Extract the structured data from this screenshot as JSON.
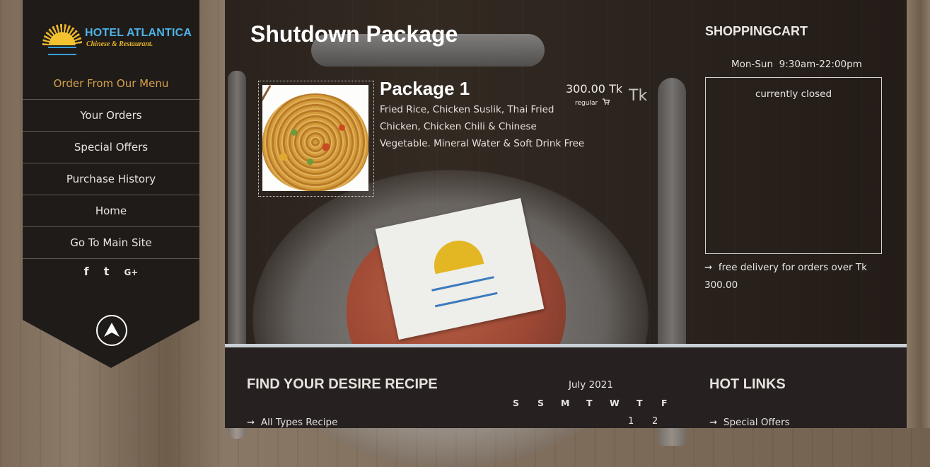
{
  "brand": {
    "name": "HOTEL ATLANTICA",
    "tagline": "Chinese & Restaurant."
  },
  "sidebar": {
    "items": [
      {
        "label": "Order From Our Menu",
        "active": true
      },
      {
        "label": "Your Orders"
      },
      {
        "label": "Special Offers"
      },
      {
        "label": "Purchase History"
      },
      {
        "label": "Home"
      },
      {
        "label": "Go To Main Site"
      }
    ],
    "social": [
      "facebook-icon",
      "twitter-icon",
      "google-plus-icon"
    ],
    "social_glyphs": {
      "facebook": "f",
      "twitter": "t",
      "google": "G+"
    }
  },
  "main": {
    "title": "Shutdown Package",
    "item": {
      "name": "Package 1",
      "description": "Fried Rice, Chicken Suslik, Thai Fried Chicken, Chicken Chili & Chinese Vegetable. Mineral Water & Soft Drink Free",
      "price": "300.00 Tk",
      "price_note": "regular",
      "currency": "Tk"
    }
  },
  "cart": {
    "title": "SHOPPINGCART",
    "hours": "Mon-Sun  9:30am-22:00pm",
    "status": "currently closed",
    "delivery_note": "free delivery for orders over Tk 300.00"
  },
  "footer": {
    "recipes": {
      "title": "FIND YOUR DESIRE RECIPE",
      "link": "All Types Recipe"
    },
    "calendar": {
      "month": "July 2021",
      "weekdays": [
        "S",
        "S",
        "M",
        "T",
        "W",
        "T",
        "F"
      ],
      "days": [
        "1",
        "2"
      ]
    },
    "hotlinks": {
      "title": "HOT LINKS",
      "link": "Special Offers"
    }
  },
  "colors": {
    "accent": "#d6a04a",
    "sidebar": "#1e1b19",
    "brand_blue": "#4fb3e6",
    "brand_gold": "#e9b42a"
  }
}
